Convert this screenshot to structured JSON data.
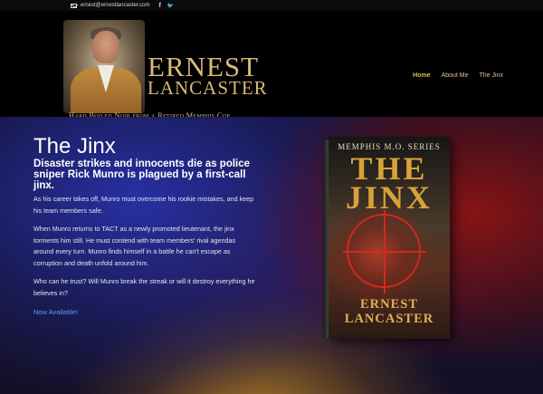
{
  "topbar": {
    "email": "ernest@ernestlancaster.com",
    "facebook_glyph": "f",
    "twitter_glyph": "🐦"
  },
  "brand": {
    "name_line1": "ERNEST",
    "name_line2": "LANCASTER",
    "tagline": "Hard Boiled Noir from a Retired Memphis Cop"
  },
  "nav": {
    "items": [
      {
        "label": "Home",
        "active": true
      },
      {
        "label": "About Me",
        "active": false
      },
      {
        "label": "The Jinx",
        "active": false
      }
    ]
  },
  "main": {
    "title": "The Jinx",
    "subtitle": "Disaster strikes and innocents die as police sniper Rick Munro is plagued by a first-call jinx.",
    "paragraphs": [
      "As his career takes off, Munro must overcome his rookie mistakes, and keep his team members safe.",
      "When Munro returns to TACT as a newly promoted lieutenant, the jinx torments him still. He must contend with team members' rival agendas around every turn. Munro finds himself in a battle he can't escape as corruption and death unfold around him.",
      "Who can he trust? Will Munro break the streak or will it destroy everything he believes in?"
    ],
    "cta": "Now Available!"
  },
  "book": {
    "series": "MEMPHIS M.O. SERIES",
    "title_line1": "THE",
    "title_line2": "JINX",
    "author_line1": "ERNEST",
    "author_line2": "LANCASTER"
  },
  "colors": {
    "gold": "#d9b978",
    "nav_active": "#e6b84a",
    "link_blue": "#4ba3e8"
  }
}
